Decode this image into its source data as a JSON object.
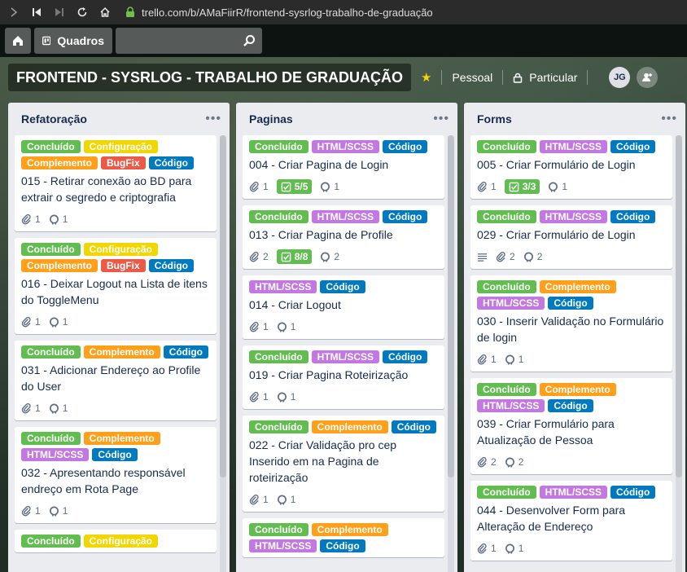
{
  "browser": {
    "url": "trello.com/b/AMaFiirR/frontend-sysrlog-trabalho-de-graduação"
  },
  "header": {
    "boards_label": "Quadros"
  },
  "board": {
    "title": "FRONTEND - SYSRLOG - TRABALHO DE GRADUAÇÃO",
    "team": "Pessoal",
    "visibility": "Particular",
    "avatar_initials": "JG"
  },
  "label_colors": {
    "Concluído": "#61bd4f",
    "Configuração": "#f2d600",
    "Complemento": "#ff9f1a",
    "BugFix": "#eb5a46",
    "Código": "#0079bf",
    "HTML/SCSS": "#c377e0"
  },
  "lists": [
    {
      "title": "Refatoração",
      "cards": [
        {
          "labels": [
            "Concluído",
            "Configuração",
            "Complemento",
            "BugFix",
            "Código"
          ],
          "title": "015 - Retirar conexão ao BD para extrair o segredo e criptografia",
          "attachments": "1",
          "github": "1"
        },
        {
          "labels": [
            "Concluído",
            "Configuração",
            "Complemento",
            "BugFix",
            "Código"
          ],
          "title": "016 - Deixar Logout na Lista de itens do ToggleMenu",
          "attachments": "1",
          "github": "1"
        },
        {
          "labels": [
            "Concluído",
            "Complemento",
            "Código"
          ],
          "title": "031 - Adicionar Endereço ao Profile do User",
          "attachments": "1",
          "github": "1"
        },
        {
          "labels": [
            "Concluído",
            "Complemento",
            "HTML/SCSS",
            "Código"
          ],
          "title": "032 - Apresentando responsável endreço em Rota Page",
          "attachments": "1",
          "github": "1"
        },
        {
          "labels": [
            "Concluído",
            "Configuração"
          ],
          "title": ""
        }
      ]
    },
    {
      "title": "Paginas",
      "cards": [
        {
          "labels": [
            "Concluído",
            "HTML/SCSS",
            "Código"
          ],
          "title": "004 - Criar Pagina de Login",
          "attachments": "1",
          "checklist": "5/5",
          "github": "1"
        },
        {
          "labels": [
            "Concluído",
            "HTML/SCSS",
            "Código"
          ],
          "title": "013 - Criar Pagina de Profile",
          "attachments": "2",
          "checklist": "8/8",
          "github": "2"
        },
        {
          "labels": [
            "HTML/SCSS",
            "Código"
          ],
          "title": "014 - Criar Logout",
          "attachments": "1",
          "github": "1"
        },
        {
          "labels": [
            "Concluído",
            "HTML/SCSS",
            "Código"
          ],
          "title": "019 - Criar Pagina Roteirização",
          "attachments": "1",
          "github": "1"
        },
        {
          "labels": [
            "Concluído",
            "Complemento",
            "Código"
          ],
          "title": "022 - Criar Validação pro cep Inserido em na Pagina de roteirização",
          "attachments": "1",
          "github": "1"
        },
        {
          "labels": [
            "Concluído",
            "Complemento",
            "HTML/SCSS",
            "Código"
          ],
          "title": ""
        }
      ]
    },
    {
      "title": "Forms",
      "cards": [
        {
          "labels": [
            "Concluído",
            "HTML/SCSS",
            "Código"
          ],
          "title": "005 - Criar Formulário de Login",
          "attachments": "1",
          "checklist": "3/3",
          "github": "1"
        },
        {
          "labels": [
            "Concluído",
            "HTML/SCSS",
            "Código"
          ],
          "title": "029 - Criar Formulário de Login",
          "description": true,
          "attachments": "2",
          "github": "2"
        },
        {
          "labels": [
            "Concluído",
            "Complemento",
            "HTML/SCSS",
            "Código"
          ],
          "title": "030 - Inserir Validação no Formulário de login",
          "attachments": "1",
          "github": "1"
        },
        {
          "labels": [
            "Concluído",
            "Complemento",
            "HTML/SCSS",
            "Código"
          ],
          "title": "039 - Criar Formulário para Atualização de Pessoa",
          "attachments": "2",
          "github": "2"
        },
        {
          "labels": [
            "Concluído",
            "HTML/SCSS",
            "Código"
          ],
          "title": "044 - Desenvolver Form para Alteração de Endereço",
          "attachments": "1",
          "github": "1"
        }
      ]
    }
  ]
}
